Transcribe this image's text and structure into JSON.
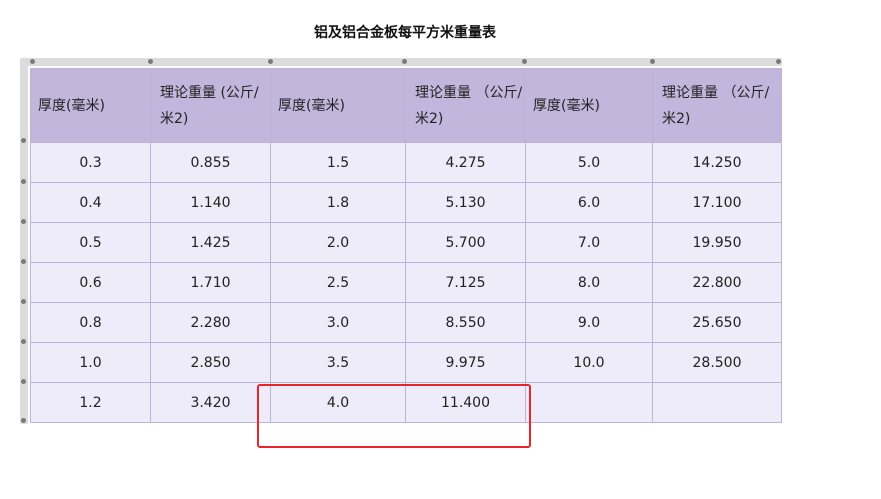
{
  "title": "铝及铝合金板每平方米重量表",
  "columns": [
    "厚度(毫米)",
    "理论重量 (公斤/米2)",
    "厚度(毫米)",
    "理论重量 （公斤/米2)",
    "厚度(毫米)",
    "理论重量 （公斤/米2)"
  ],
  "rows": [
    [
      "0.3",
      "0.855",
      "1.5",
      "4.275",
      "5.0",
      "14.250"
    ],
    [
      "0.4",
      "1.140",
      "1.8",
      "5.130",
      "6.0",
      "17.100"
    ],
    [
      "0.5",
      "1.425",
      "2.0",
      "5.700",
      "7.0",
      "19.950"
    ],
    [
      "0.6",
      "1.710",
      "2.5",
      "7.125",
      "8.0",
      "22.800"
    ],
    [
      "0.8",
      "2.280",
      "3.0",
      "8.550",
      "9.0",
      "25.650"
    ],
    [
      "1.0",
      "2.850",
      "3.5",
      "9.975",
      "10.0",
      "28.500"
    ],
    [
      "1.2",
      "3.420",
      "4.0",
      "11.400",
      "",
      ""
    ]
  ],
  "colors": {
    "header_bg": "#c3b6dc",
    "cell_bg": "#eeecf8",
    "border": "#bdb3d8",
    "highlight": "#e8252a"
  }
}
